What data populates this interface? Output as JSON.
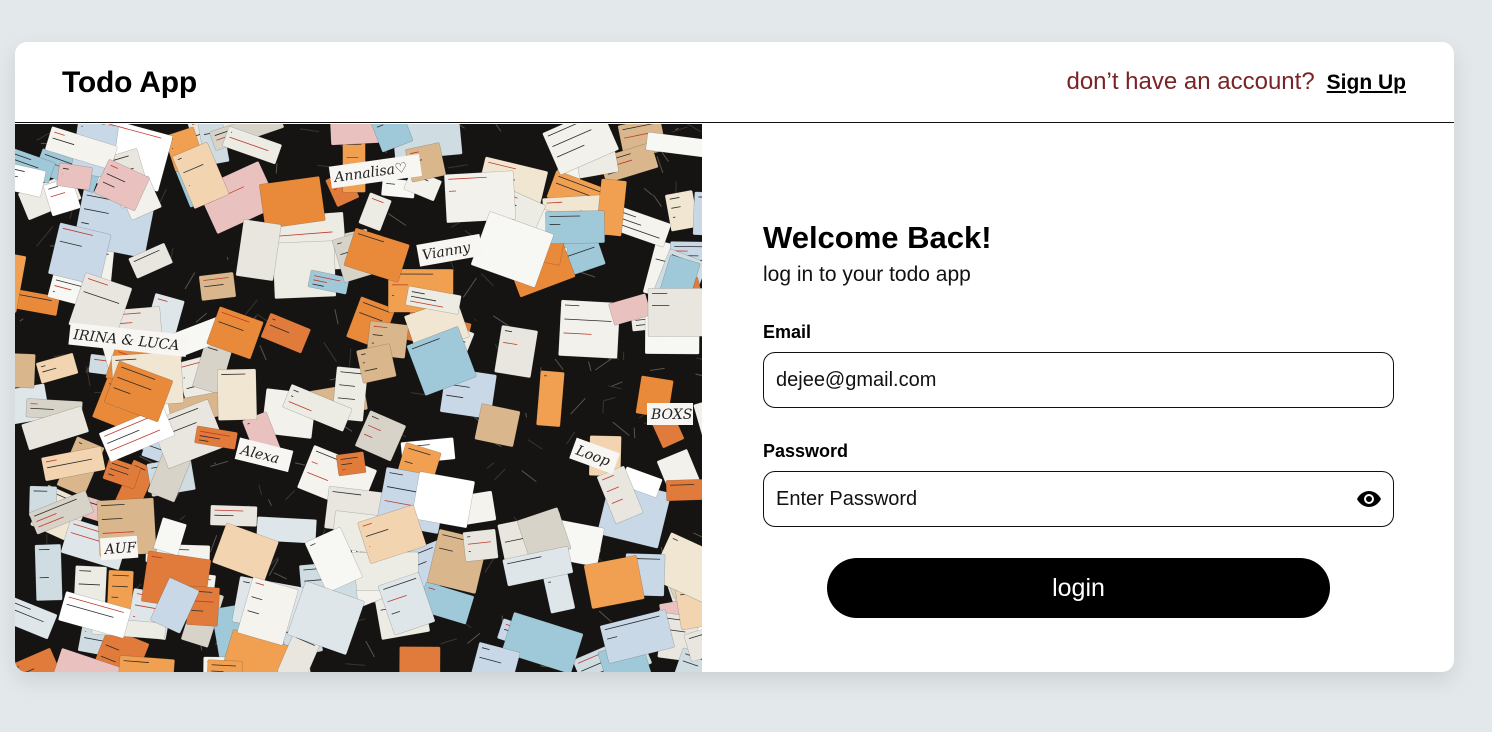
{
  "header": {
    "app_title": "Todo App",
    "signup_prompt": "don’t have an account?",
    "signup_link": "Sign Up"
  },
  "hero_image": {
    "icon": "sticky-notes-collage",
    "note_texts": [
      "Annalisa♡",
      "IRINA & LUCA",
      "Alexa",
      "BOXS",
      "AUF",
      "Vianny",
      "Loop"
    ]
  },
  "form": {
    "welcome": "Welcome Back!",
    "subtitle": "log in to your todo app",
    "email_label": "Email",
    "email_value": "dejee@gmail.com",
    "password_label": "Password",
    "password_placeholder": "Enter Password",
    "toggle_icon": "eye-icon",
    "login_label": "login"
  },
  "colors": {
    "page_bg": "#e3e8eb",
    "prompt_text": "#7a2326",
    "button_bg": "#000000",
    "button_text": "#ffffff"
  }
}
